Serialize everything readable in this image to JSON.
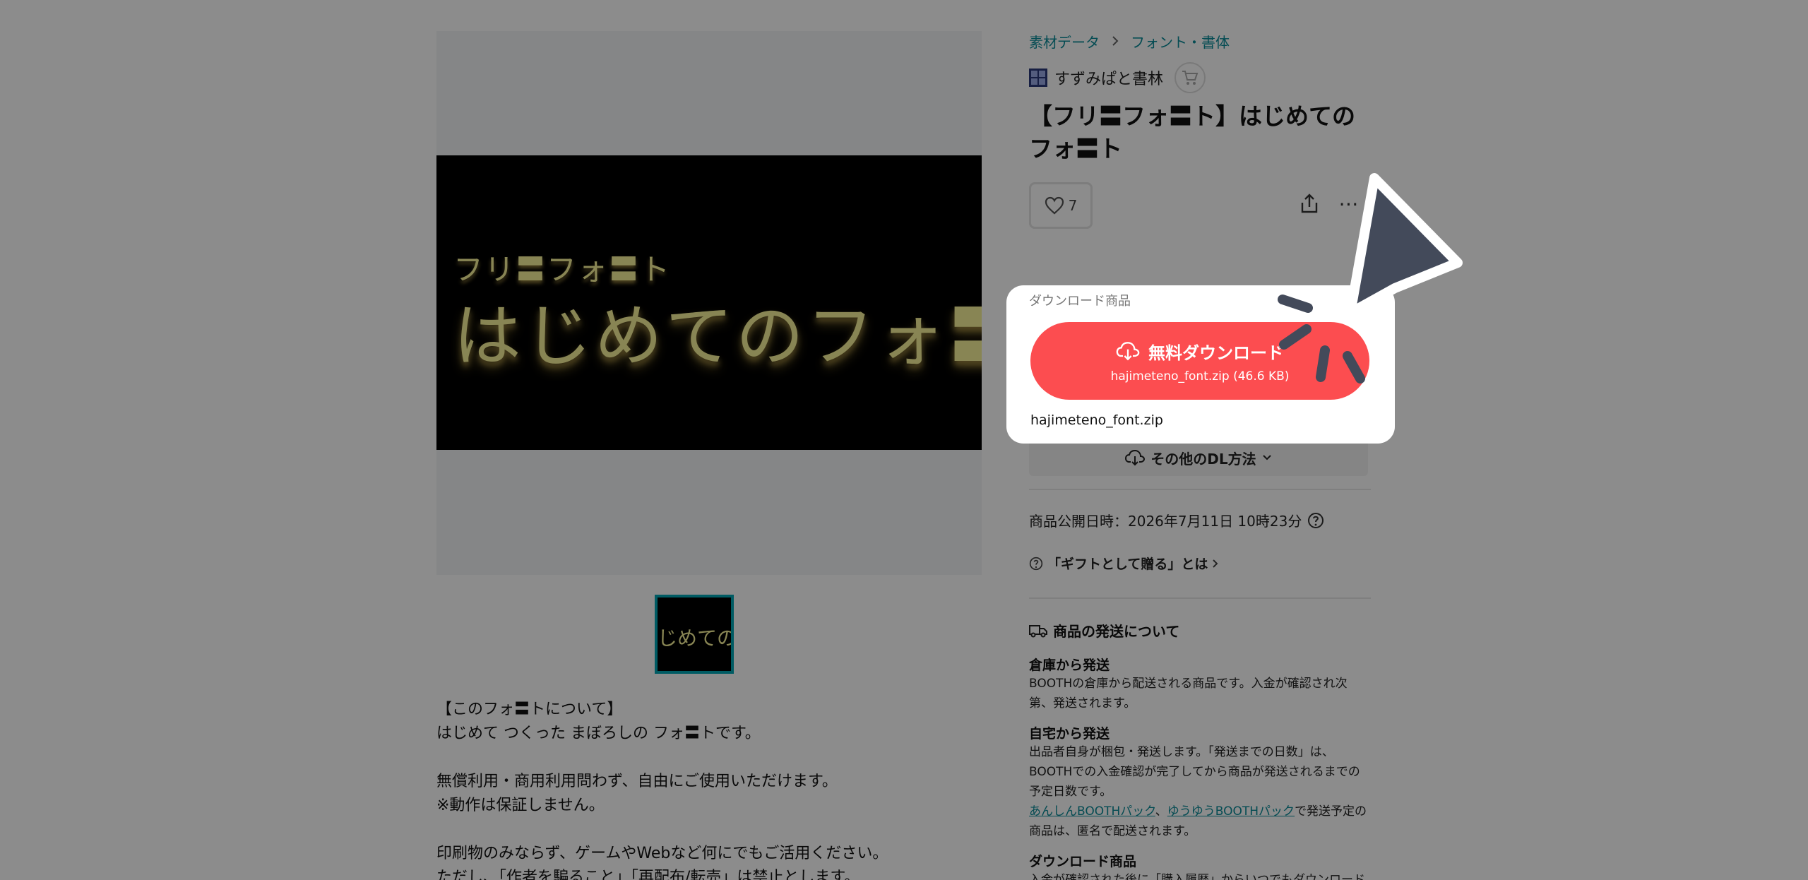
{
  "breadcrumb": {
    "category": "素材データ",
    "subcategory": "フォント・書体"
  },
  "shop": {
    "name": "すずみぱと書林"
  },
  "product": {
    "title": "【フリ〓フォ〓ト】はじめてのフォ〓ト",
    "likes": "7",
    "banner_small": "フリ〓フォ〓ト",
    "banner_big": "はじめてのフォ〓ト",
    "thumb_text": "じめてのフォ"
  },
  "download": {
    "label": "ダウンロード商品",
    "button_title": "無料ダウンロード",
    "button_file": "hajimeteno_font.zip (46.6 KB)",
    "filename": "hajimeteno_font.zip",
    "other_methods": "その他のDL方法"
  },
  "published": "商品公開日時：2026年7月11日 10時23分",
  "gift": "「ギフトとして贈る」とは",
  "shipping": {
    "title": "商品の発送について",
    "warehouse_title": "倉庫から発送",
    "warehouse_text": "BOOTHの倉庫から配送される商品です。入金が確認され次第、発送されます。",
    "home_title": "自宅から発送",
    "home_text": "出品者自身が梱包・発送します。「発送までの日数」は、BOOTHでの入金確認が完了してから商品が発送されるまでの予定日数です。",
    "link1": "あんしんBOOTHパック",
    "sep": "、",
    "link2": "ゆうゆうBOOTHパック",
    "link_tail": "で発送予定の商品は、匿名で配送されます。",
    "download_title": "ダウンロード商品",
    "download_text": "入金が確認された後に「購入履歴」からいつでもダウンロード"
  },
  "description": {
    "heading": "【このフォ〓トについて】",
    "line1": "はじめて つくった まぼろしの フォ〓トです。",
    "line2": "無償利用・商用利用問わず、自由にご使用いただけます。",
    "line3": "※動作は保証しません。",
    "line4": "印刷物のみならず、ゲームやWebなど何にでもご活用ください。",
    "line5": "ただし、「作者を騙ること」「再配布/転売」は禁止とします。"
  },
  "colors": {
    "accent": "#fc4d50",
    "link": "#0a8a97",
    "thumb_border": "#00a7b5"
  }
}
